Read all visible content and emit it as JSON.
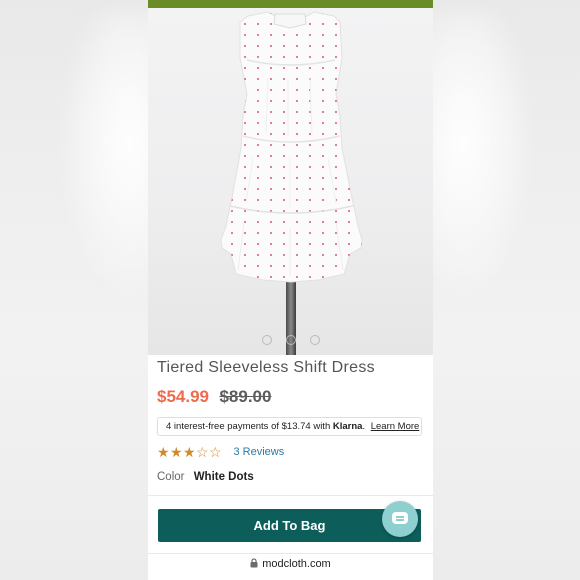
{
  "product": {
    "title": "Tiered Sleeveless Shift Dress",
    "sale_price": "$54.99",
    "original_price": "$89.00",
    "image_carousel": {
      "total": 3,
      "active_index": 0
    }
  },
  "klarna": {
    "prefix": "4 interest-free payments of $13.74 with",
    "brand": "Klarna",
    "suffix": ".",
    "learn_more": "Learn More"
  },
  "rating": {
    "stars": 3,
    "max_stars": 5,
    "reviews_label": "3 Reviews"
  },
  "color": {
    "label": "Color",
    "value": "White Dots"
  },
  "cart": {
    "add_label": "Add To Bag"
  },
  "footer": {
    "url": "modcloth.com"
  },
  "colors": {
    "top_bar": "#6a8c28",
    "sale_price": "#ef6b4b",
    "button": "#0d5e5a",
    "chat_fab": "#8ecfd0",
    "stars": "#d08a2e",
    "link": "#2a79a6"
  },
  "icons": [
    "lock-icon",
    "chat-icon",
    "star-icon"
  ]
}
